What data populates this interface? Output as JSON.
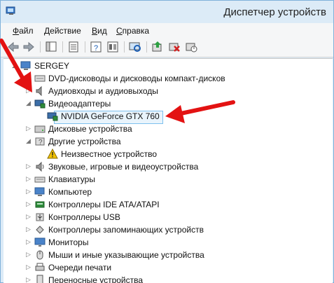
{
  "window": {
    "title": "Диспетчер устройств"
  },
  "menu": {
    "items": [
      {
        "key": "Ф",
        "rest": "айл"
      },
      {
        "key": "Д",
        "rest": "ействие"
      },
      {
        "key": "В",
        "rest": "ид"
      },
      {
        "key": "С",
        "rest": "правка"
      }
    ]
  },
  "tree": {
    "root": "SERGEY",
    "items": [
      {
        "label": "DVD-дисководы и дисководы компакт-дисков"
      },
      {
        "label": "Аудиовходы и аудиовыходы"
      },
      {
        "label": "Видеоадаптеры"
      },
      {
        "label": "NVIDIA GeForce GTX 760"
      },
      {
        "label": "Дисковые устройства"
      },
      {
        "label": "Другие устройства"
      },
      {
        "label": "Неизвестное устройство"
      },
      {
        "label": "Звуковые, игровые и видеоустройства"
      },
      {
        "label": "Клавиатуры"
      },
      {
        "label": "Компьютер"
      },
      {
        "label": "Контроллеры IDE ATA/ATAPI"
      },
      {
        "label": "Контроллеры USB"
      },
      {
        "label": "Контроллеры запоминающих устройств"
      },
      {
        "label": "Мониторы"
      },
      {
        "label": "Мыши и иные указывающие устройства"
      },
      {
        "label": "Очереди печати"
      },
      {
        "label": "Переносные устройства"
      }
    ]
  },
  "colors": {
    "annotation_arrow": "#e31212",
    "selection": "#7ec0ee",
    "titlebar": "#dcebf7"
  }
}
